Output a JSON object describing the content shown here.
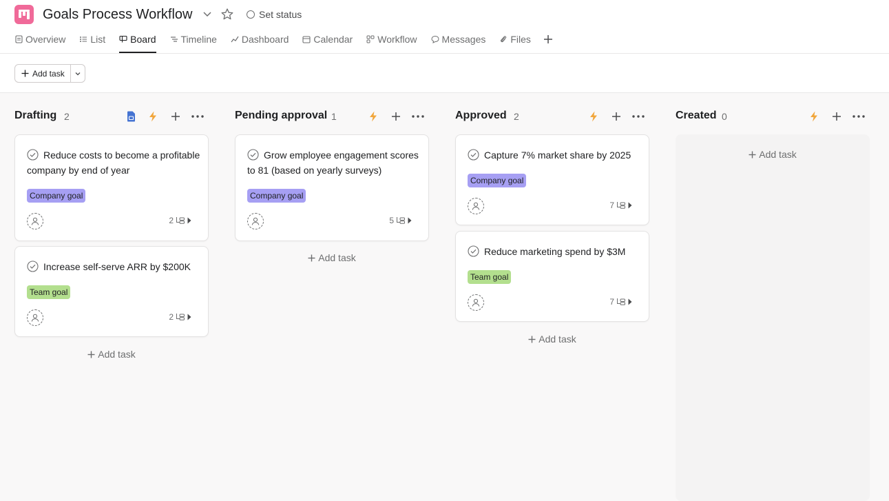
{
  "project": {
    "title": "Goals Process Workflow",
    "set_status": "Set status"
  },
  "tabs": [
    {
      "label": "Overview"
    },
    {
      "label": "List"
    },
    {
      "label": "Board"
    },
    {
      "label": "Timeline"
    },
    {
      "label": "Dashboard"
    },
    {
      "label": "Calendar"
    },
    {
      "label": "Workflow"
    },
    {
      "label": "Messages"
    },
    {
      "label": "Files"
    }
  ],
  "toolbar": {
    "add_task": "Add task"
  },
  "columns": [
    {
      "name": "Drafting",
      "count": "2",
      "add_task": "Add task",
      "cards": [
        {
          "title": "Reduce costs to become a profitable company by end of year",
          "tag": "Company goal",
          "subtasks": "2"
        },
        {
          "title": "Increase self-serve ARR by $200K",
          "tag": "Team goal",
          "subtasks": "2"
        }
      ]
    },
    {
      "name": "Pending approval",
      "count": "1",
      "add_task": "Add task",
      "cards": [
        {
          "title": "Grow employee engagement scores to 81 (based on yearly surveys)",
          "tag": "Company goal",
          "subtasks": "5"
        }
      ]
    },
    {
      "name": "Approved",
      "count": "2",
      "add_task": "Add task",
      "cards": [
        {
          "title": "Capture 7% market share by 2025",
          "tag": "Company goal",
          "subtasks": "7"
        },
        {
          "title": "Reduce marketing spend by $3M",
          "tag": "Team goal",
          "subtasks": "7"
        }
      ]
    },
    {
      "name": "Created",
      "count": "0",
      "add_task": "Add task",
      "cards": []
    }
  ],
  "colors": {
    "brand_icon": "#f06a99",
    "company_tag": "#a69ff3",
    "team_tag": "#b3df8e",
    "rule_bolt": "#f1a63c",
    "doc_icon": "#4573d2"
  },
  "icons": {
    "app": "board-app-icon",
    "chevron": "chevron-down-icon",
    "star": "star-icon",
    "add": "plus-icon",
    "more": "ellipsis-icon",
    "rule": "lightning-icon",
    "doc": "document-icon",
    "check": "check-circle-icon",
    "assignee": "user-icon",
    "subtask": "subtask-icon"
  }
}
